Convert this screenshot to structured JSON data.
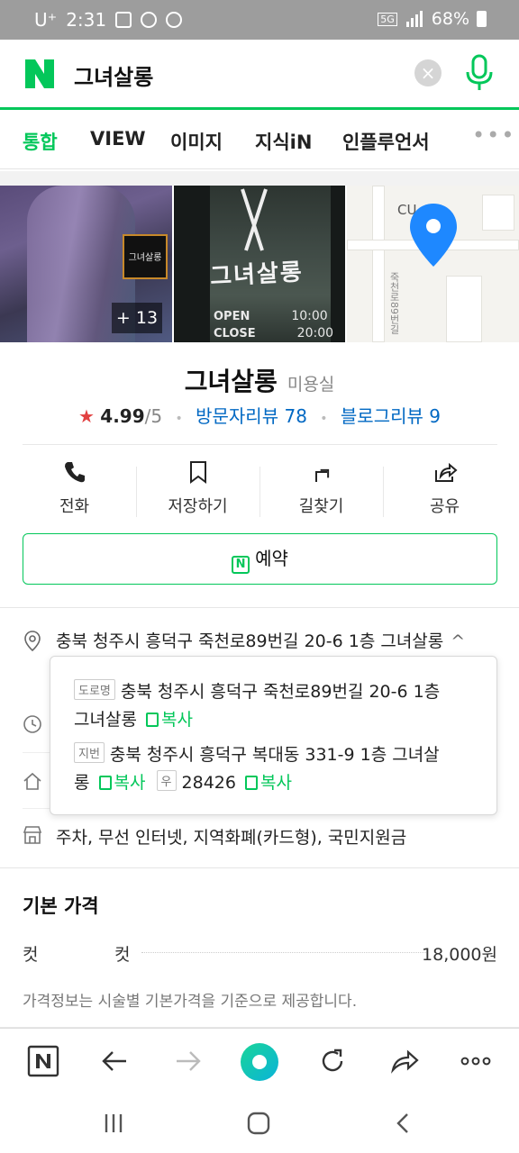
{
  "status": {
    "carrier": "U⁺",
    "time": "2:31",
    "battery": "68%",
    "network": "5G"
  },
  "search": {
    "query": "그녀살롱",
    "clear_glyph": "×"
  },
  "tabs": [
    {
      "label": "통합",
      "active": true
    },
    {
      "label": "VIEW"
    },
    {
      "label": "이미지"
    },
    {
      "label": "지식iN"
    },
    {
      "label": "인플루언서"
    }
  ],
  "tabs_more": "•••",
  "photos": {
    "count_label": "+ 13",
    "logo_text": "그녀살롱",
    "sign_text": "그녀살롱",
    "open_label": "OPEN",
    "open_time": "10:00",
    "close_label": "CLOSE",
    "close_time": "20:00",
    "map_poi": "CU",
    "map_road": "죽천로89번길"
  },
  "place": {
    "name": "그녀살롱",
    "category": "미용실",
    "score": "4.99",
    "score_max": "/5",
    "visitor_reviews": "방문자리뷰 78",
    "blog_reviews": "블로그리뷰 9"
  },
  "actions": [
    {
      "label": "전화",
      "icon": "phone-icon"
    },
    {
      "label": "저장하기",
      "icon": "bookmark-icon"
    },
    {
      "label": "길찾기",
      "icon": "directions-icon"
    },
    {
      "label": "공유",
      "icon": "share-icon"
    }
  ],
  "reserve": {
    "label": "예약",
    "icon_letter": "N"
  },
  "address": {
    "summary": "충북 청주시 흥덕구 죽천로89번길 20-6 1층 그녀살롱",
    "chevron": "^",
    "road_tag": "도로명",
    "road_line1": "충북 청주시 흥덕구 죽천로89번길 20-6 1층",
    "road_line2": "그녀살롱",
    "lot_tag": "지번",
    "lot_line1": "충북 청주시 흥덕구 복대동 331-9 1층 그녀살",
    "lot_line2": "롱",
    "zip_tag": "우",
    "zip": "28426",
    "copy_label": "복사"
  },
  "facilities": "주차, 무선 인터넷, 지역화폐(카드형), 국민지원금",
  "price": {
    "title": "기본 가격",
    "rows": [
      {
        "category": "컷",
        "name": "컷",
        "price": "18,000원"
      }
    ],
    "note": "가격정보는 시술별 기본가격을 기준으로 제공합니다."
  },
  "colors": {
    "brand_green": "#03c75a",
    "link_blue": "#0068c3",
    "star_red": "#e24040"
  }
}
